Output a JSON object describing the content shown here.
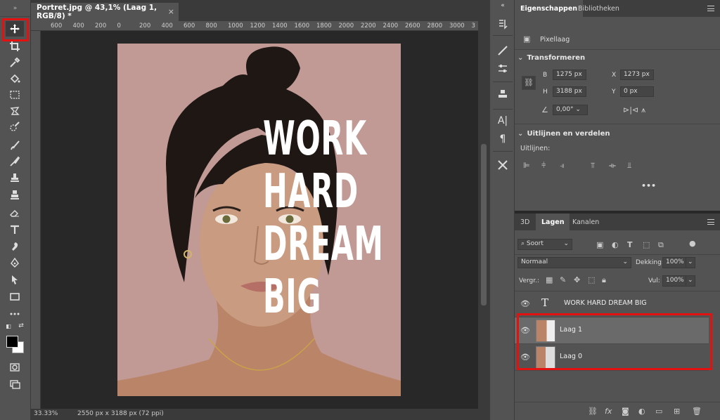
{
  "document": {
    "tab_title": "Portret.jpg @ 43,1% (Laag 1, RGB/8) *",
    "close_label": "×",
    "poster_text": "WORK\nHARD\nDREAM\nBIG",
    "ruler_ticks": [
      "600",
      "400",
      "200",
      "0",
      "200",
      "400",
      "600",
      "800",
      "1000",
      "1200",
      "1400",
      "1600",
      "1800",
      "2000",
      "2200",
      "2400",
      "2600",
      "2800",
      "3000",
      "3"
    ]
  },
  "status": {
    "zoom": "33.33%",
    "info": "2550 px x 3188 px (72 ppi)"
  },
  "properties": {
    "tabs": [
      "Eigenschappen",
      "Bibliotheken"
    ],
    "type_label": "Pixellaag",
    "transform_title": "Transformeren",
    "w_label": "B",
    "w_value": "1275 px",
    "h_label": "H",
    "h_value": "3188 px",
    "x_label": "X",
    "x_value": "1273 px",
    "y_label": "Y",
    "y_value": "0 px",
    "angle_value": "0,00°",
    "align_title": "Uitlijnen en verdelen",
    "align_label": "Uitlijnen:",
    "more_label": "•••"
  },
  "layers_panel": {
    "tabs": [
      "3D",
      "Lagen",
      "Kanalen"
    ],
    "filter_label": "Soort",
    "blend_mode": "Normaal",
    "opacity_label": "Dekking:",
    "opacity_value": "100%",
    "lock_label": "Vergr.:",
    "fill_label": "Vul:",
    "fill_value": "100%",
    "layers": [
      {
        "name": "WORK HARD DREAM BIG",
        "kind": "text"
      },
      {
        "name": "Laag 1",
        "kind": "pixel",
        "selected": true
      },
      {
        "name": "Laag 0",
        "kind": "pixel"
      }
    ]
  },
  "bottom_icons": [
    "link-icon",
    "fx-icon",
    "mask-icon",
    "adjustment-icon",
    "group-icon",
    "new-layer-icon",
    "trash-icon"
  ],
  "colors": {
    "highlight": "#e3110f",
    "photo_bg": "#c29a95"
  }
}
